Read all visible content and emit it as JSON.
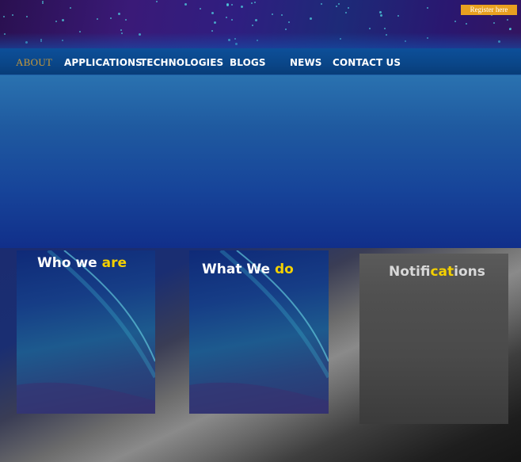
{
  "header": {
    "register_label": "Register here"
  },
  "nav": {
    "items": [
      {
        "label": "ABOUT",
        "active": true
      },
      {
        "label": "APPLICATIONS"
      },
      {
        "label": "TECHNOLOGIES"
      },
      {
        "label": "BLOGS"
      },
      {
        "label": "NEWS"
      },
      {
        "label": "CONTACT US"
      }
    ]
  },
  "panels": {
    "who": {
      "title_main": "Who we ",
      "title_highlight": "are"
    },
    "what": {
      "title_main": "What We ",
      "title_highlight": "do"
    },
    "notifications": {
      "title_a": "Notifi",
      "title_highlight": "cat",
      "title_b": "ions"
    }
  },
  "colors": {
    "accent": "#f3d000",
    "register_button": "#e8a020",
    "nav_active": "#c89a3a",
    "nav_bar": "#0a4688"
  }
}
